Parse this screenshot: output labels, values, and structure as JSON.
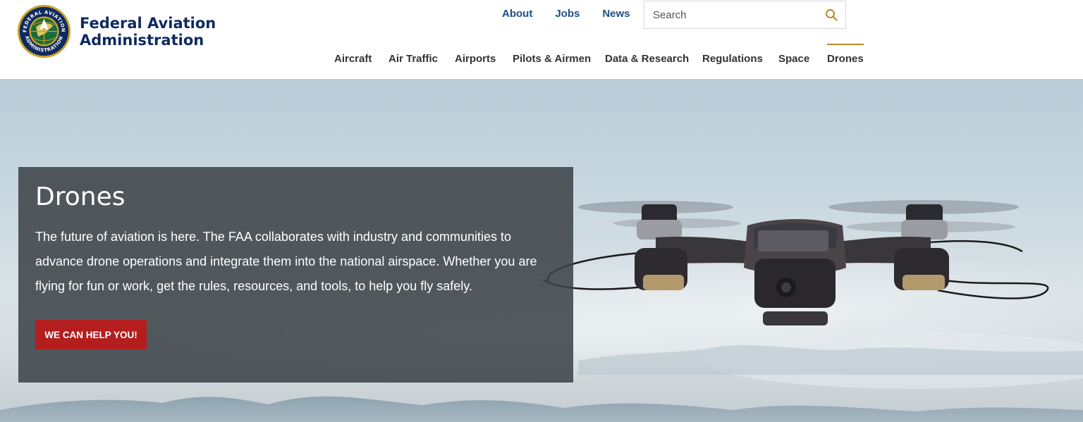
{
  "brand": {
    "line1": "Federal Aviation",
    "line2": "Administration",
    "seal_text_top": "FEDERAL AVIATION",
    "seal_text_bottom": "ADMINISTRATION",
    "seal_icon": "faa-seal-icon"
  },
  "utility_nav": [
    {
      "label": "About"
    },
    {
      "label": "Jobs"
    },
    {
      "label": "News"
    }
  ],
  "search": {
    "placeholder": "Search",
    "value": "",
    "icon": "search-icon"
  },
  "main_nav": [
    {
      "label": "Aircraft"
    },
    {
      "label": "Air Traffic"
    },
    {
      "label": "Airports"
    },
    {
      "label": "Pilots & Airmen"
    },
    {
      "label": "Data & Research"
    },
    {
      "label": "Regulations"
    },
    {
      "label": "Space"
    },
    {
      "label": "Drones",
      "active": true
    }
  ],
  "hero": {
    "title": "Drones",
    "body": "The future of aviation is here. The FAA collaborates with industry and communities to advance drone operations and integrate them into the national airspace. Whether you are flying for fun or work, get the rules, resources, and tools, to help you fly safely.",
    "cta_label": "WE CAN HELP YOU!",
    "image_subject": "drone-photo"
  },
  "colors": {
    "brand_navy": "#0f2a5f",
    "link_blue": "#1f4e86",
    "active_underline": "#b58b2c",
    "cta_red": "#b41e1e",
    "panel_gray": "#3e4449"
  }
}
